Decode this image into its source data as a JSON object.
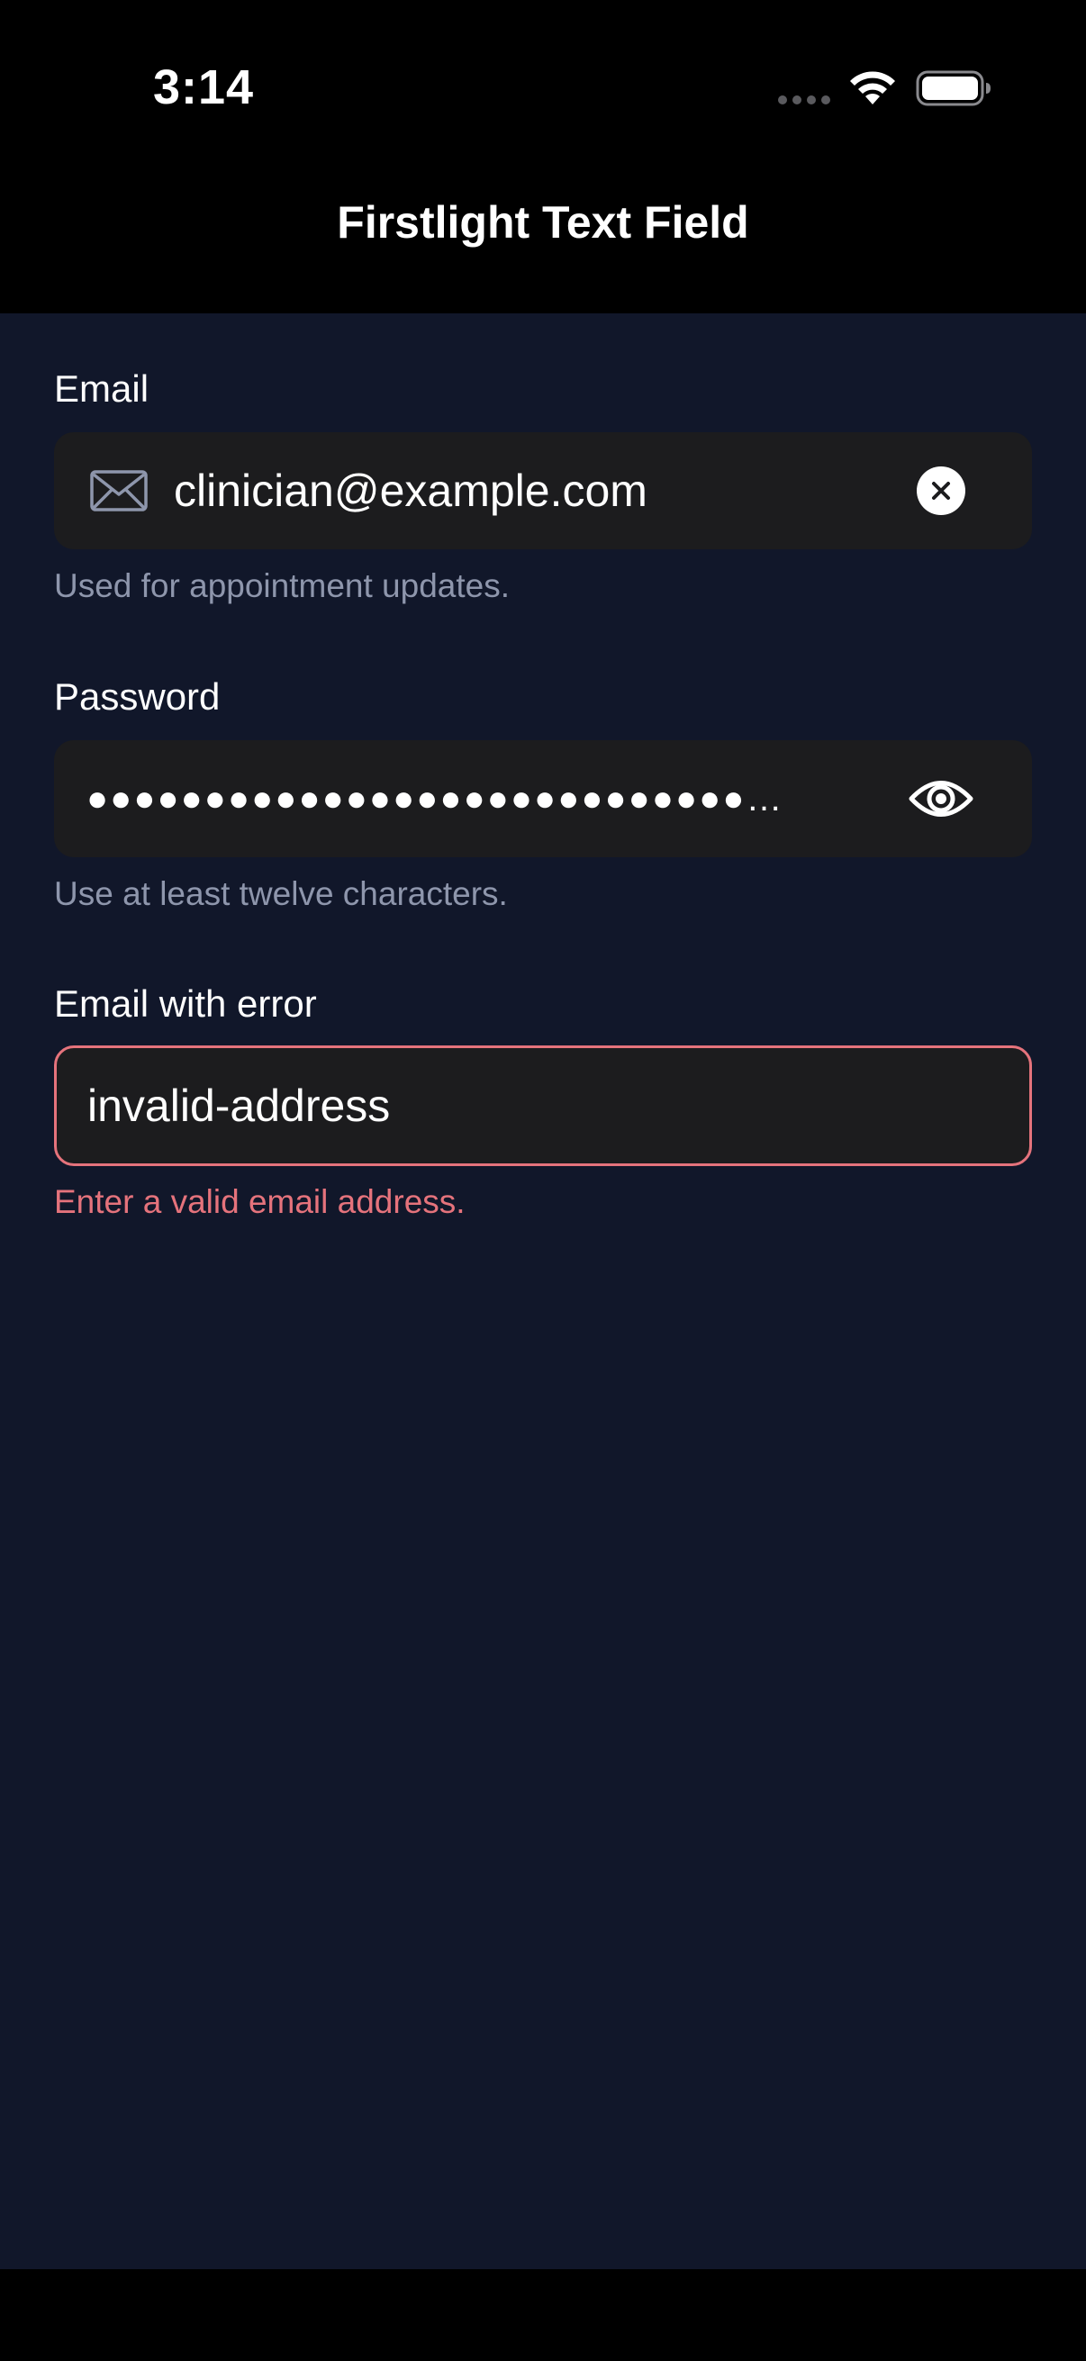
{
  "status_bar": {
    "time": "3:14"
  },
  "nav": {
    "title": "Firstlight Text Field"
  },
  "fields": {
    "email": {
      "label": "Email",
      "value": "clinician@example.com",
      "helper": "Used for appointment updates.",
      "leading_icon": "envelope-icon",
      "trailing_icon": "clear-circle-icon"
    },
    "password": {
      "label": "Password",
      "masked_value": "●●●●●●●●●●●●●●●●●●●●●●●●●●●●…",
      "helper": "Use at least twelve characters.",
      "trailing_icon": "eye-icon"
    },
    "email_error": {
      "label": "Email with error",
      "value": "invalid-address",
      "error": "Enter a valid email address."
    }
  },
  "colors": {
    "background": "#11172a",
    "field_background": "#1c1c1e",
    "helper_text": "#8e96ac",
    "error": "#e5737c",
    "text": "#ffffff"
  }
}
